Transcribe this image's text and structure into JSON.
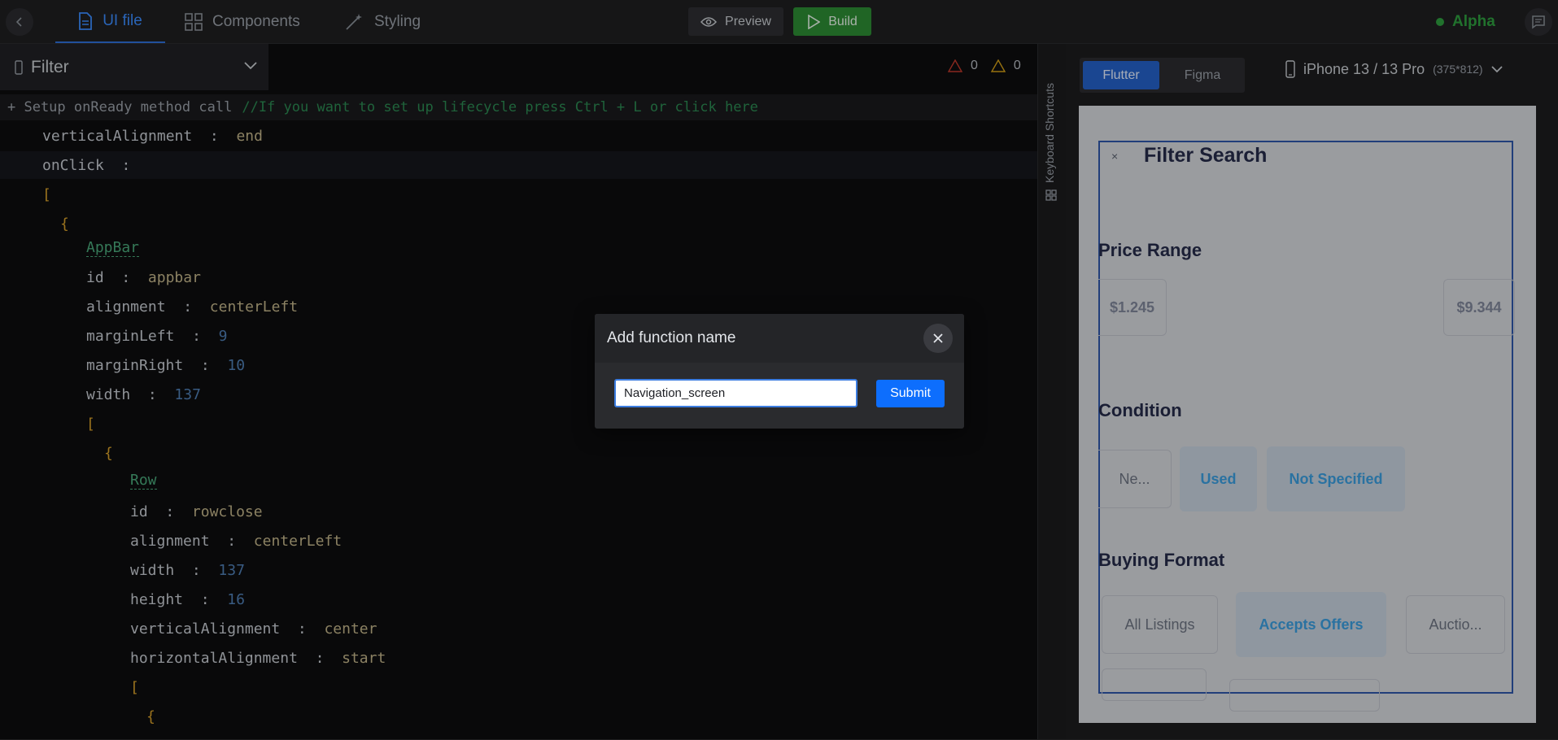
{
  "topbar": {
    "tabs": [
      {
        "label": "UI file",
        "icon": "file-icon",
        "active": true
      },
      {
        "label": "Components",
        "icon": "grid-icon",
        "active": false
      },
      {
        "label": "Styling",
        "icon": "magic-wand-icon",
        "active": false
      }
    ],
    "preview_label": "Preview",
    "build_label": "Build",
    "status_label": "Alpha"
  },
  "editor": {
    "filter_title": "Filter",
    "errors": "0",
    "warnings": "0",
    "setup_text": "+ Setup onReady method call",
    "setup_hint": "//If you want to set up lifecycle press Ctrl + L or click here",
    "lines": {
      "l1k": "verticalAlignment",
      "l1v": "end",
      "l2k": "onClick",
      "l3": "[",
      "l4": "{",
      "l5": "AppBar",
      "l6k": "id",
      "l6v": "appbar",
      "l7k": "alignment",
      "l7v": "centerLeft",
      "l8k": "marginLeft",
      "l8v": "9",
      "l9k": "marginRight",
      "l9v": "10",
      "l10k": "width",
      "l10v": "137",
      "l11": "[",
      "l12": "{",
      "l13": "Row",
      "l14k": "id",
      "l14v": "rowclose",
      "l15k": "alignment",
      "l15v": "centerLeft",
      "l16k": "width",
      "l16v": "137",
      "l17k": "height",
      "l17v": "16",
      "l18k": "verticalAlignment",
      "l18v": "center",
      "l19k": "horizontalAlignment",
      "l19v": "start",
      "l20": "[",
      "l21": "{"
    },
    "colon": ":"
  },
  "shortcuts_label": "Keyboard Shortcuts",
  "preview_panel": {
    "flutter_label": "Flutter",
    "figma_label": "Figma",
    "device_name": "iPhone 13 / 13 Pro",
    "device_size": "(375*812)"
  },
  "phone": {
    "close": "×",
    "title": "Filter Search",
    "price_heading": "Price Range",
    "price_min": "$1.245",
    "price_max": "$9.344",
    "condition_heading": "Condition",
    "cond_new": "Ne...",
    "cond_used": "Used",
    "cond_not": "Not Specified",
    "buying_heading": "Buying Format",
    "buy_all": "All Listings",
    "buy_offers": "Accepts Offers",
    "buy_auction": "Auctio..."
  },
  "modal": {
    "title": "Add function name",
    "input_value": "Navigation_screen",
    "submit_label": "Submit"
  },
  "colors": {
    "accent": "#2462c9",
    "build": "#2d8c34",
    "status": "#2f9e3f",
    "submit": "#0d6efd"
  }
}
